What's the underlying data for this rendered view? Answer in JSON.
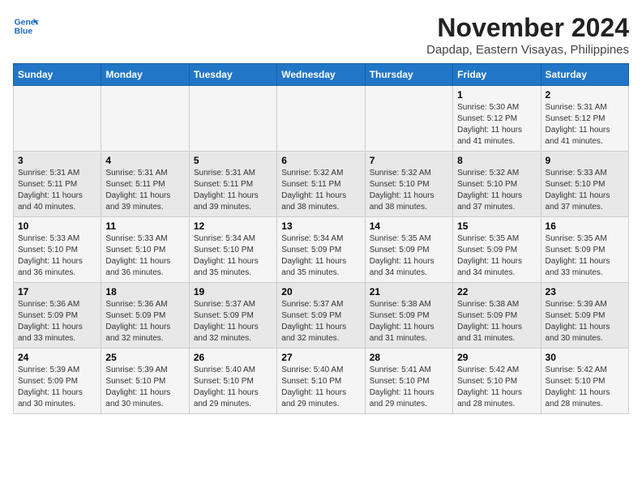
{
  "header": {
    "logo_line1": "General",
    "logo_line2": "Blue",
    "title": "November 2024",
    "subtitle": "Dapdap, Eastern Visayas, Philippines"
  },
  "weekdays": [
    "Sunday",
    "Monday",
    "Tuesday",
    "Wednesday",
    "Thursday",
    "Friday",
    "Saturday"
  ],
  "weeks": [
    [
      {
        "day": "",
        "info": ""
      },
      {
        "day": "",
        "info": ""
      },
      {
        "day": "",
        "info": ""
      },
      {
        "day": "",
        "info": ""
      },
      {
        "day": "",
        "info": ""
      },
      {
        "day": "1",
        "info": "Sunrise: 5:30 AM\nSunset: 5:12 PM\nDaylight: 11 hours and 41 minutes."
      },
      {
        "day": "2",
        "info": "Sunrise: 5:31 AM\nSunset: 5:12 PM\nDaylight: 11 hours and 41 minutes."
      }
    ],
    [
      {
        "day": "3",
        "info": "Sunrise: 5:31 AM\nSunset: 5:11 PM\nDaylight: 11 hours and 40 minutes."
      },
      {
        "day": "4",
        "info": "Sunrise: 5:31 AM\nSunset: 5:11 PM\nDaylight: 11 hours and 39 minutes."
      },
      {
        "day": "5",
        "info": "Sunrise: 5:31 AM\nSunset: 5:11 PM\nDaylight: 11 hours and 39 minutes."
      },
      {
        "day": "6",
        "info": "Sunrise: 5:32 AM\nSunset: 5:11 PM\nDaylight: 11 hours and 38 minutes."
      },
      {
        "day": "7",
        "info": "Sunrise: 5:32 AM\nSunset: 5:10 PM\nDaylight: 11 hours and 38 minutes."
      },
      {
        "day": "8",
        "info": "Sunrise: 5:32 AM\nSunset: 5:10 PM\nDaylight: 11 hours and 37 minutes."
      },
      {
        "day": "9",
        "info": "Sunrise: 5:33 AM\nSunset: 5:10 PM\nDaylight: 11 hours and 37 minutes."
      }
    ],
    [
      {
        "day": "10",
        "info": "Sunrise: 5:33 AM\nSunset: 5:10 PM\nDaylight: 11 hours and 36 minutes."
      },
      {
        "day": "11",
        "info": "Sunrise: 5:33 AM\nSunset: 5:10 PM\nDaylight: 11 hours and 36 minutes."
      },
      {
        "day": "12",
        "info": "Sunrise: 5:34 AM\nSunset: 5:10 PM\nDaylight: 11 hours and 35 minutes."
      },
      {
        "day": "13",
        "info": "Sunrise: 5:34 AM\nSunset: 5:09 PM\nDaylight: 11 hours and 35 minutes."
      },
      {
        "day": "14",
        "info": "Sunrise: 5:35 AM\nSunset: 5:09 PM\nDaylight: 11 hours and 34 minutes."
      },
      {
        "day": "15",
        "info": "Sunrise: 5:35 AM\nSunset: 5:09 PM\nDaylight: 11 hours and 34 minutes."
      },
      {
        "day": "16",
        "info": "Sunrise: 5:35 AM\nSunset: 5:09 PM\nDaylight: 11 hours and 33 minutes."
      }
    ],
    [
      {
        "day": "17",
        "info": "Sunrise: 5:36 AM\nSunset: 5:09 PM\nDaylight: 11 hours and 33 minutes."
      },
      {
        "day": "18",
        "info": "Sunrise: 5:36 AM\nSunset: 5:09 PM\nDaylight: 11 hours and 32 minutes."
      },
      {
        "day": "19",
        "info": "Sunrise: 5:37 AM\nSunset: 5:09 PM\nDaylight: 11 hours and 32 minutes."
      },
      {
        "day": "20",
        "info": "Sunrise: 5:37 AM\nSunset: 5:09 PM\nDaylight: 11 hours and 32 minutes."
      },
      {
        "day": "21",
        "info": "Sunrise: 5:38 AM\nSunset: 5:09 PM\nDaylight: 11 hours and 31 minutes."
      },
      {
        "day": "22",
        "info": "Sunrise: 5:38 AM\nSunset: 5:09 PM\nDaylight: 11 hours and 31 minutes."
      },
      {
        "day": "23",
        "info": "Sunrise: 5:39 AM\nSunset: 5:09 PM\nDaylight: 11 hours and 30 minutes."
      }
    ],
    [
      {
        "day": "24",
        "info": "Sunrise: 5:39 AM\nSunset: 5:09 PM\nDaylight: 11 hours and 30 minutes."
      },
      {
        "day": "25",
        "info": "Sunrise: 5:39 AM\nSunset: 5:10 PM\nDaylight: 11 hours and 30 minutes."
      },
      {
        "day": "26",
        "info": "Sunrise: 5:40 AM\nSunset: 5:10 PM\nDaylight: 11 hours and 29 minutes."
      },
      {
        "day": "27",
        "info": "Sunrise: 5:40 AM\nSunset: 5:10 PM\nDaylight: 11 hours and 29 minutes."
      },
      {
        "day": "28",
        "info": "Sunrise: 5:41 AM\nSunset: 5:10 PM\nDaylight: 11 hours and 29 minutes."
      },
      {
        "day": "29",
        "info": "Sunrise: 5:42 AM\nSunset: 5:10 PM\nDaylight: 11 hours and 28 minutes."
      },
      {
        "day": "30",
        "info": "Sunrise: 5:42 AM\nSunset: 5:10 PM\nDaylight: 11 hours and 28 minutes."
      }
    ]
  ]
}
